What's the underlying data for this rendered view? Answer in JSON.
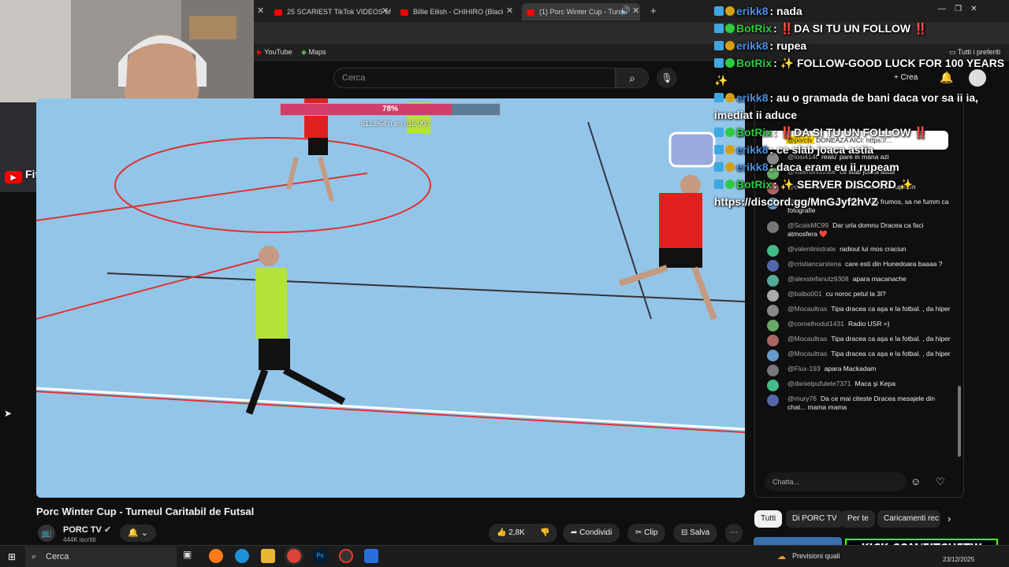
{
  "browser": {
    "tabs": [
      {
        "label": "25 SCARIEST TikTok VIDEOS of"
      },
      {
        "label": "Billie Eilish - CHIHIRO (Black Co"
      },
      {
        "label": "(1) Porc Winter Cup - Turne"
      }
    ],
    "new_tab": "+",
    "bookmarks": [
      {
        "label": "YouTube"
      },
      {
        "label": "Maps"
      }
    ],
    "favorites": "Tutti i preferiti"
  },
  "youtube": {
    "search_placeholder": "Cerca",
    "create_label": "Crea",
    "video_title": "Porc Winter Cup - Turneul Caritabil de Futsal",
    "channel_name": "PORC TV",
    "subscribers": "444K iscritti",
    "actions": {
      "likes": "2,8K",
      "share": "Condividi",
      "clip": "Clip",
      "save": "Salva"
    },
    "chips": [
      {
        "label": "Tutti"
      },
      {
        "label": "Di PORC TV"
      },
      {
        "label": "Per te"
      },
      {
        "label": "Caricamenti rec"
      }
    ]
  },
  "donation_bar": {
    "percent": 78,
    "label": "78%",
    "sub": "611,864.0 en 615,000"
  },
  "webcam": {
    "streamer": "Fitchftw"
  },
  "live_chat": {
    "pinned_user": "@porctv",
    "pinned_text": "DONEAZA AICI: https://...",
    "input_placeholder": "Chatta...",
    "messages": [
      {
        "user": "@losi414t",
        "text": "realu' pare in mana azi"
      },
      {
        "user": "@valentinistrate",
        "text": "ce slab joaca astia"
      },
      {
        "user": "@cristiancarstena",
        "text": "daca eram eu ii rupeam"
      },
      {
        "user": "@lucastel1917",
        "text": "cine sa fie asa frumos, sa ne fumm ca fotografie"
      },
      {
        "user": "@ScaisMC99",
        "text": "Dar urla domnu Dracea ca faci atmosfera ❤️"
      },
      {
        "user": "@valentinistrate",
        "text": "radioul lui mos craciun"
      },
      {
        "user": "@cristiancarstena",
        "text": "care esti din Hunedoara baaaa ?"
      },
      {
        "user": "@alexstefanutz9308",
        "text": "apara macanache"
      },
      {
        "user": "@balbo001",
        "text": "cu noroc petul la 3l?"
      },
      {
        "user": "@Mocaultras",
        "text": "Tipa dracea ca aşa e la fotbal. , da hiper"
      },
      {
        "user": "@cornelhodut1431",
        "text": "Radio USR =)"
      },
      {
        "user": "@Mocaultras",
        "text": "Tipa dracea ca aşa e la fotbal. , da hiper"
      },
      {
        "user": "@Mocaultras",
        "text": "Tipa dracea ca aşa e la fotbal. , da hiper"
      },
      {
        "user": "@Flux-193",
        "text": "apara Mackadam"
      },
      {
        "user": "@danielpufulete7371",
        "text": "Maca şi Kepa"
      },
      {
        "user": "@mury76",
        "text": "Da ce mai citeste Dracea mesajele din chat... mama mama"
      }
    ]
  },
  "overlay_chat": [
    {
      "user": "erikk8",
      "text": ": nada",
      "color": "#4a90e2"
    },
    {
      "user": "BotRix",
      "text": ": ‼️DA SI TU UN FOLLOW ‼️",
      "color": "#2ecc40"
    },
    {
      "user": "erikk8",
      "text": ": rupea",
      "color": "#4a90e2"
    },
    {
      "user": "BotRix",
      "text": ": ✨ FOLLOW-GOOD LUCK FOR 100 YEARS ✨",
      "color": "#2ecc40"
    },
    {
      "user": "erikk8",
      "text": ": au o gramada de bani daca vor sa ii ia, imediat ii aduce",
      "color": "#4a90e2"
    },
    {
      "user": "BotRix",
      "text": ": ‼️DA SI TU UN FOLLOW ‼️",
      "color": "#2ecc40"
    },
    {
      "user": "erikk8",
      "text": ": ce slab joaca astia",
      "color": "#4a90e2"
    },
    {
      "user": "erikk8",
      "text": ": daca eram eu ii rupeam",
      "color": "#4a90e2"
    },
    {
      "user": "BotRix",
      "text": ": ✨ SERVER DISCORD ✨ https://discord.gg/MnGJyf2hVZ",
      "color": "#2ecc40"
    }
  ],
  "taskbar": {
    "search_label": "Cerca",
    "tray_text": "Previsioni quali",
    "date": "23/12/2025"
  },
  "kick_banner": "KICK.COM/FITCHFTW",
  "colors": {
    "kick_green": "#53fc18",
    "yt_red": "#ff0000",
    "donation_fill": "#d33d6a"
  }
}
